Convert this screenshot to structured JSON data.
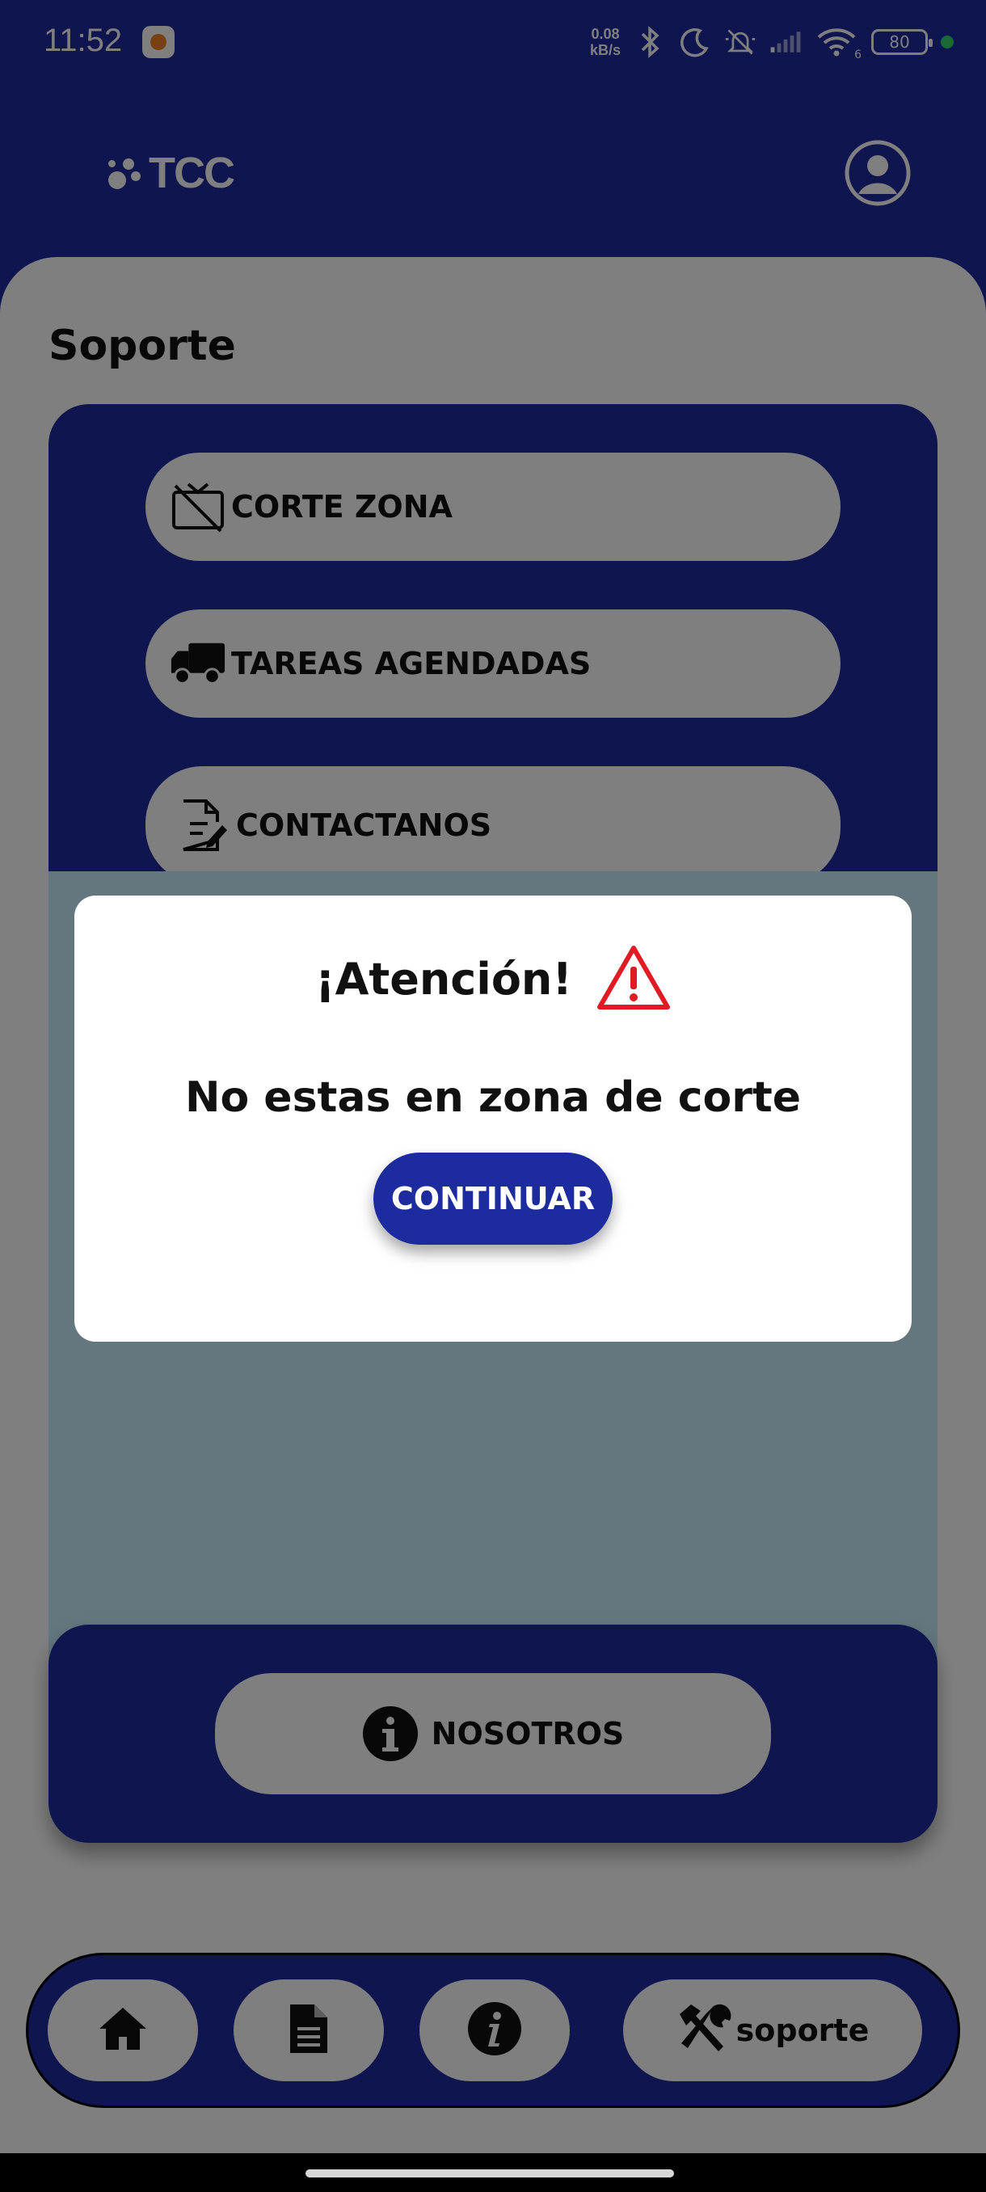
{
  "status_bar": {
    "time": "11:52",
    "net_speed_value": "0.08",
    "net_speed_unit": "kB/s",
    "wifi_badge": "6",
    "battery": "80"
  },
  "header": {
    "logo_text": "TCC"
  },
  "page": {
    "title": "Soporte",
    "menu": [
      {
        "label": "CORTE ZONA",
        "icon": "tv-off-icon"
      },
      {
        "label": "TAREAS AGENDADAS",
        "icon": "truck-icon"
      },
      {
        "label": "CONTACTANOS",
        "icon": "document-edit-icon"
      }
    ],
    "nosotros_label": "NOSOTROS"
  },
  "bottom_nav": {
    "items": [
      {
        "name": "home",
        "icon": "home-icon"
      },
      {
        "name": "documents",
        "icon": "document-icon"
      },
      {
        "name": "info",
        "icon": "info-icon"
      }
    ],
    "active_label": "soporte"
  },
  "dialog": {
    "title": "¡Atención!",
    "message": "No estas en zona de corte",
    "button": "CONTINUAR"
  },
  "colors": {
    "brand_blue": "#1c2b9e",
    "warning_red": "#e01b24",
    "sheet_light": "#c8eefc"
  }
}
